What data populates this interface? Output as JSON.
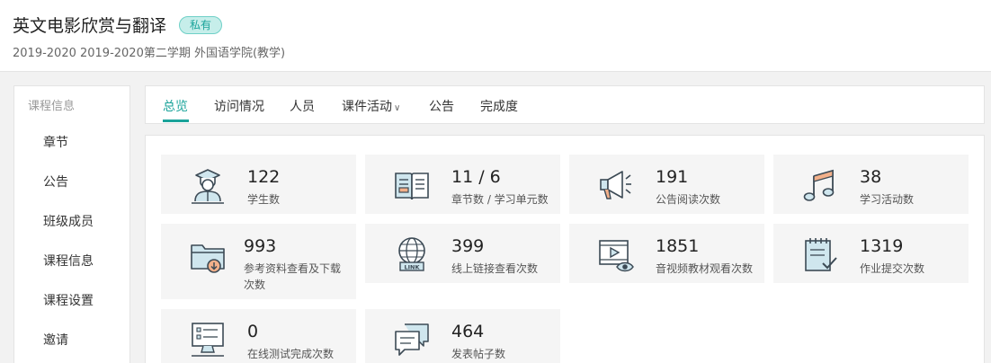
{
  "header": {
    "title": "英文电影欣赏与翻译",
    "badge": "私有",
    "subtitle": "2019-2020 2019-2020第二学期 外国语学院(教学)"
  },
  "sidebar": {
    "heading": "课程信息",
    "items": [
      {
        "label": "章节"
      },
      {
        "label": "公告"
      },
      {
        "label": "班级成员"
      },
      {
        "label": "课程信息"
      },
      {
        "label": "课程设置"
      },
      {
        "label": "邀请"
      }
    ]
  },
  "tabs": [
    {
      "label": "总览"
    },
    {
      "label": "访问情况"
    },
    {
      "label": "人员"
    },
    {
      "label": "课件活动"
    },
    {
      "label": "公告"
    },
    {
      "label": "完成度"
    }
  ],
  "stats": [
    {
      "value": "122",
      "label": "学生数",
      "icon": "student-icon"
    },
    {
      "value": "11 / 6",
      "label": "章节数 / 学习单元数",
      "icon": "book-icon"
    },
    {
      "value": "191",
      "label": "公告阅读次数",
      "icon": "megaphone-icon"
    },
    {
      "value": "38",
      "label": "学习活动数",
      "icon": "music-note-icon"
    },
    {
      "value": "993",
      "label": "参考资料查看及下载次数",
      "icon": "folder-download-icon"
    },
    {
      "value": "399",
      "label": "线上链接查看次数",
      "icon": "globe-link-icon"
    },
    {
      "value": "1851",
      "label": "音视频教材观看次数",
      "icon": "video-view-icon"
    },
    {
      "value": "1319",
      "label": "作业提交次数",
      "icon": "homework-icon"
    },
    {
      "value": "0",
      "label": "在线测试完成次数",
      "icon": "online-test-icon"
    },
    {
      "value": "464",
      "label": "发表帖子数",
      "icon": "post-icon"
    }
  ],
  "colors": {
    "accent": "#1aa39a",
    "badge_bg": "#c6eeea",
    "icon_stroke": "#3c4a55",
    "icon_fill": "#cfe6ee",
    "icon_accent": "#f2b08a"
  }
}
